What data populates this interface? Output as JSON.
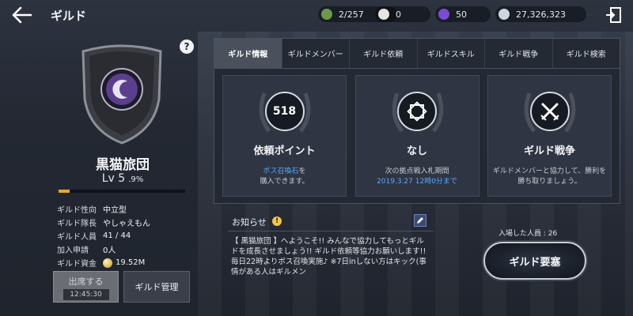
{
  "header": {
    "title": "ギルド",
    "resources": [
      {
        "icon": "guild-token-icon",
        "value": "2/257",
        "color": "#6a9a4a"
      },
      {
        "icon": "pearl-icon",
        "value": "0",
        "color": "#e8e4df"
      },
      {
        "icon": "purple-gem-icon",
        "value": "50",
        "color": "#7b4bd1"
      },
      {
        "icon": "silver-coin-icon",
        "value": "27,326,323",
        "color": "#cfd6df"
      }
    ]
  },
  "guild": {
    "name": "黒猫旅団",
    "level": "Lv 5",
    "exp_percent": ".9%",
    "exp_fraction": 0.09,
    "info": [
      {
        "key": "ギルド性向",
        "value": "中立型"
      },
      {
        "key": "ギルド隊長",
        "value": "やしゃえもん"
      },
      {
        "key": "ギルド人員",
        "value": "41 / 44"
      },
      {
        "key": "加入申請",
        "value": "0人"
      },
      {
        "key": "ギルド資金",
        "value": "19.52M"
      }
    ]
  },
  "buttons": {
    "attend_label": "出席する",
    "attend_timer": "12:45:30",
    "manage_label": "ギルド管理",
    "help": "?",
    "request_label": "ギルド要塞"
  },
  "tabs": [
    "ギルド情報",
    "ギルドメンバー",
    "ギルド依頼",
    "ギルドスキル",
    "ギルド戦争",
    "ギルド検索"
  ],
  "cards": [
    {
      "badge": "518",
      "title": "依頼ポイント",
      "desc_highlight": "ボス召喚石",
      "desc_line1_rest": "を",
      "desc_line2": "購入できます。"
    },
    {
      "badge": "",
      "title": "なし",
      "desc_line1": "次の拠点戦入札期間",
      "desc_highlight": "2019.3.27 12時0分まで"
    },
    {
      "badge": "",
      "title": "ギルド戦争",
      "desc_line1": "ギルドメンバーと協力して、勝利を",
      "desc_line2": "勝ち取りましょう。"
    }
  ],
  "notice": {
    "title": "お知らせ",
    "warn": "!",
    "body": "【 黒猫旅団 】へようこそ!! みんなで協力してもっとギルドを成長させましょう!! ギルド依頼等協力お願いします!! 毎日22時よりボス召喚実施♪ ※7日inしない方はキック(事情がある人はギルメン"
  },
  "entered": "入場した人員 : 26"
}
